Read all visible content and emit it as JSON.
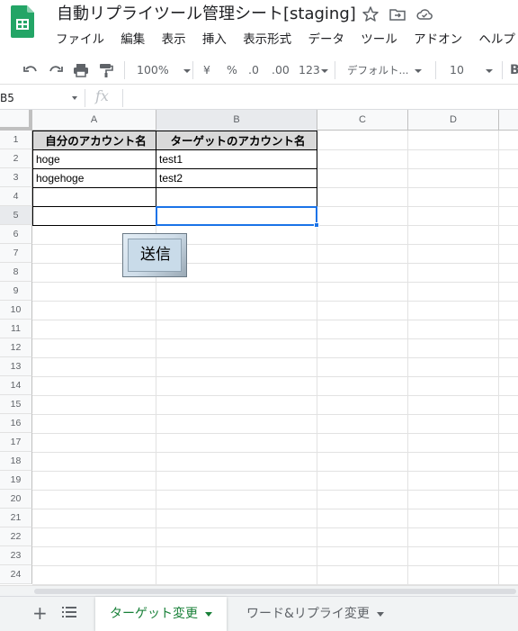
{
  "app": {
    "title": "自動リプライツール管理シート[staging]",
    "accent_color": "#188038",
    "selection_color": "#1a73e8"
  },
  "menu": [
    "ファイル",
    "編集",
    "表示",
    "挿入",
    "表示形式",
    "データ",
    "ツール",
    "アドオン",
    "ヘルプ"
  ],
  "toolbar": {
    "zoom": "100%",
    "currency": "¥",
    "percent": "%",
    "decrease_decimals": ".0",
    "increase_decimals": ".00",
    "more_formats": "123",
    "font": "デフォルト...",
    "font_size": "10",
    "icons": [
      "undo-icon",
      "redo-icon",
      "print-icon",
      "paint-format-icon",
      "bold-icon"
    ]
  },
  "formula_bar": {
    "name_box": "B5",
    "fx": "fx",
    "value": ""
  },
  "grid": {
    "columns": [
      "A",
      "B",
      "C",
      "D"
    ],
    "rows": [
      "1",
      "2",
      "3",
      "4",
      "5",
      "6",
      "7",
      "8",
      "9",
      "10",
      "11",
      "12",
      "13",
      "14",
      "15",
      "16",
      "17",
      "18",
      "19",
      "20",
      "21",
      "22",
      "23",
      "24"
    ],
    "selected_cell": "B5",
    "header": [
      "自分のアカウント名",
      "ターゲットのアカウント名"
    ],
    "data": [
      [
        "hoge",
        "test1"
      ],
      [
        "hogehoge",
        "test2"
      ],
      [
        "",
        ""
      ],
      [
        "",
        ""
      ]
    ]
  },
  "drawing": {
    "send_button_label": "送信"
  },
  "sheet_tabs": {
    "add_label": "+",
    "tabs": [
      {
        "label": "ターゲット変更",
        "active": true
      },
      {
        "label": "ワード&リプライ変更",
        "active": false
      }
    ]
  }
}
